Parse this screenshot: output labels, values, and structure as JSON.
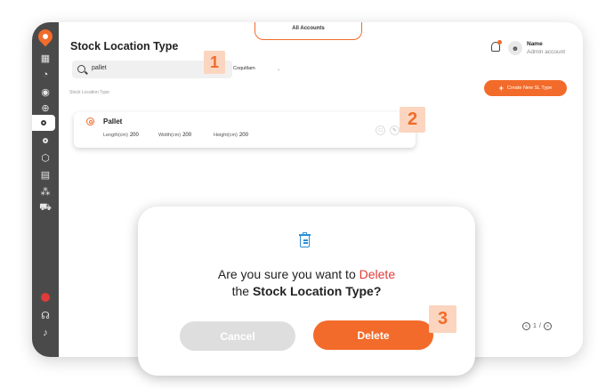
{
  "header": {
    "tab_label": "All Accounts",
    "page_title": "Stock Location Type",
    "user_name": "Name",
    "user_role": "Admin account"
  },
  "toolbar": {
    "search_value": "pallet",
    "location_select": "Coquitlam",
    "breadcrumb": "Stock Location Type",
    "create_label": "Create New SL Type"
  },
  "card": {
    "title": "Pallet",
    "length_label": "Length(cm)",
    "length_value": "200",
    "width_label": "Width(cm)",
    "width_value": "200",
    "height_label": "Height(cm)",
    "height_value": "200"
  },
  "pagination": {
    "page": "1",
    "separator": "/"
  },
  "badges": {
    "step1": "1",
    "step2": "2",
    "step3": "3"
  },
  "modal": {
    "line1_prefix": "Are you sure you want to",
    "line1_emph": "Delete",
    "line2_prefix": "the",
    "line2_emph": "Stock Location Type?",
    "cancel_label": "Cancel",
    "delete_label": "Delete"
  },
  "colors": {
    "accent": "#f26b2a",
    "danger": "#e03a3a",
    "sidebar": "#4a4a4a",
    "icon_blue": "#2a8fd6"
  }
}
